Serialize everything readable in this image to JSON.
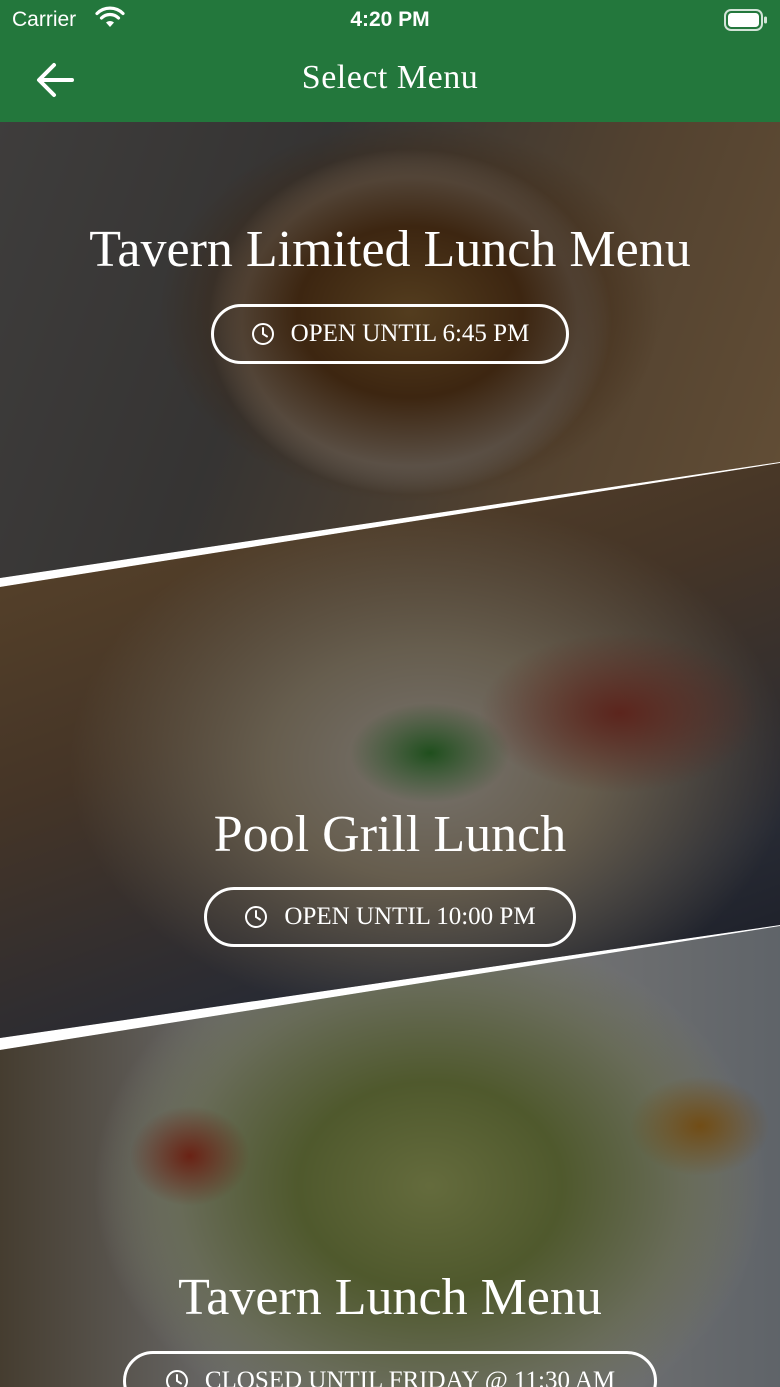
{
  "status_bar": {
    "carrier": "Carrier",
    "time": "4:20 PM"
  },
  "header": {
    "title": "Select Menu",
    "back_icon": "arrow-left-icon"
  },
  "menus": [
    {
      "name": "Tavern Limited Lunch Menu",
      "status": "OPEN UNTIL 6:45 PM",
      "icon": "clock-icon"
    },
    {
      "name": "Pool Grill Lunch",
      "status": "OPEN UNTIL 10:00 PM",
      "icon": "clock-icon"
    },
    {
      "name": "Tavern Lunch Menu",
      "status": "CLOSED UNTIL FRIDAY @ 11:30 AM",
      "icon": "clock-icon"
    }
  ],
  "colors": {
    "header_bg": "#23773c",
    "text": "#ffffff",
    "divider": "#ffffff"
  }
}
